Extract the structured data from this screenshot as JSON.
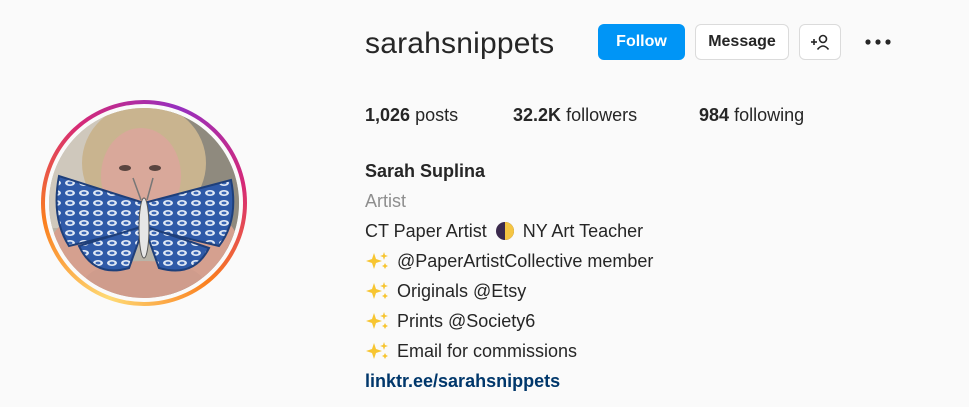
{
  "profile": {
    "username": "sarahsnippets",
    "follow_label": "Follow",
    "message_label": "Message",
    "suggest_icon": "add-person-icon",
    "more_icon": "more-options-icon"
  },
  "stats": {
    "posts_count": "1,026",
    "posts_label": "posts",
    "followers_count": "32.2K",
    "followers_label": "followers",
    "following_count": "984",
    "following_label": "following"
  },
  "bio": {
    "name": "Sarah Suplina",
    "category": "Artist",
    "line1_a": "CT Paper Artist",
    "line1_b": "NY Art Teacher",
    "line2": "@PaperArtistCollective member",
    "line3": "Originals @Etsy",
    "line4": "Prints @Society6",
    "line5": "Email for commissions",
    "link": "linktr.ee/sarahsnippets"
  },
  "colors": {
    "follow_blue": "#0095f6",
    "link_blue": "#00376b",
    "muted_gray": "#8e8e8e"
  }
}
